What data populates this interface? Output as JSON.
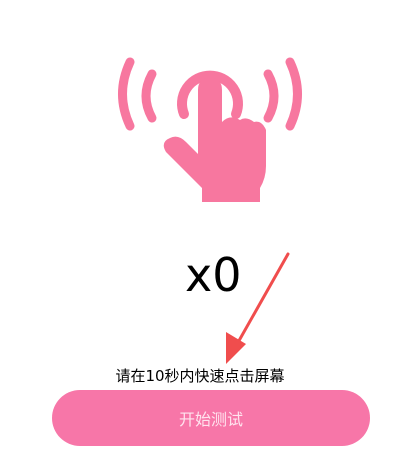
{
  "illustration": {
    "icon": "tap-gesture-icon",
    "color": "#f7779f"
  },
  "counter": {
    "text": "x0"
  },
  "annotation": {
    "icon": "red-arrow-icon",
    "color": "#f04d4d"
  },
  "instruction": {
    "text": "请在10秒内快速点击屏幕"
  },
  "start_button": {
    "label": "开始测试",
    "background": "#f776a8",
    "text_color": "#ffe3ee"
  }
}
